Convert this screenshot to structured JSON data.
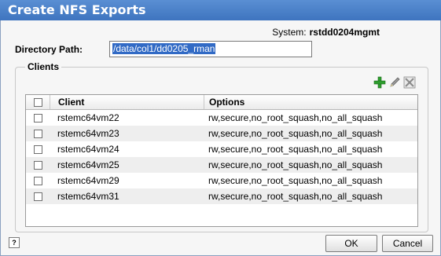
{
  "window": {
    "title": "Create NFS Exports"
  },
  "system": {
    "label": "System:",
    "value": "rstdd0204mgmt"
  },
  "directory": {
    "label": "Directory Path:",
    "value": "/data/col1/dd0205_rman"
  },
  "clients": {
    "legend": "Clients",
    "toolbar": {
      "add_icon": "plus-icon",
      "edit_icon": "pencil-icon",
      "delete_icon": "delete-icon"
    },
    "columns": {
      "client": "Client",
      "options": "Options"
    },
    "rows": [
      {
        "client": "rstemc64vm22",
        "options": "rw,secure,no_root_squash,no_all_squash"
      },
      {
        "client": "rstemc64vm23",
        "options": "rw,secure,no_root_squash,no_all_squash"
      },
      {
        "client": "rstemc64vm24",
        "options": "rw,secure,no_root_squash,no_all_squash"
      },
      {
        "client": "rstemc64vm25",
        "options": "rw,secure,no_root_squash,no_all_squash"
      },
      {
        "client": "rstemc64vm29",
        "options": "rw,secure,no_root_squash,no_all_squash"
      },
      {
        "client": "rstemc64vm31",
        "options": "rw,secure,no_root_squash,no_all_squash"
      }
    ]
  },
  "footer": {
    "help": "?",
    "ok": "OK",
    "cancel": "Cancel"
  },
  "colors": {
    "titlebar": "#4a80c8",
    "selection": "#316ac5",
    "add_green": "#2e9e2e",
    "delete_gray": "#8a8a8a"
  }
}
